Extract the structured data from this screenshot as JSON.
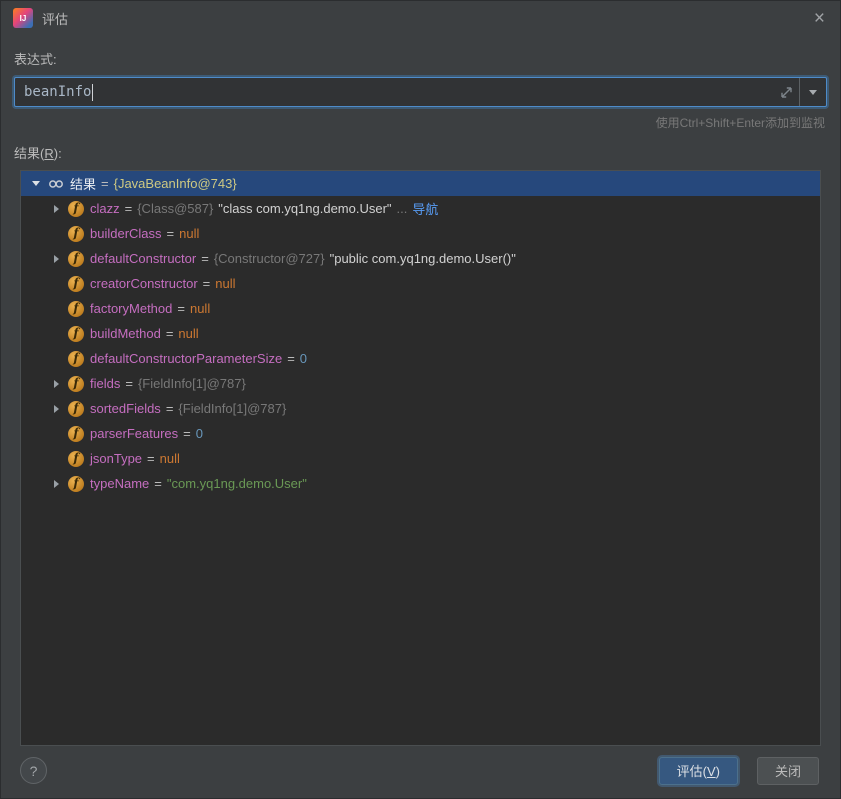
{
  "dialog": {
    "title": "评估"
  },
  "icons": {
    "close": "×",
    "help": "?",
    "logo": "IJ",
    "field": "f"
  },
  "colors": {
    "selection_bg": "#26487C",
    "primary_button_bg": "#365880",
    "focus_border_blue": "#4E8BC9",
    "field_name_pink": "#C56EC0",
    "string_green": "#6A9955",
    "null_orange": "#CC7832",
    "number_blue": "#6897BB",
    "reference_gray": "#787878",
    "link_blue": "#589DF6"
  },
  "expression": {
    "label": "表达式:",
    "value": "beanInfo",
    "hint": "使用Ctrl+Shift+Enter添加到监视"
  },
  "result": {
    "label_prefix": "结果(",
    "label_mnemonic": "R",
    "label_suffix": "):",
    "root": {
      "expand": true,
      "name": "结果",
      "values": [
        {
          "type": "eq",
          "text": "="
        },
        {
          "type": "rootref",
          "text": "{JavaBeanInfo@743}"
        }
      ]
    },
    "rows": [
      {
        "expand": true,
        "name": "clazz",
        "values": [
          {
            "type": "eq",
            "text": "="
          },
          {
            "type": "ref",
            "text": "{Class@587}"
          },
          {
            "type": "plain",
            "text": "\"class com.yq1ng.demo.User\""
          },
          {
            "type": "dots",
            "text": "..."
          },
          {
            "type": "link",
            "text": "导航"
          }
        ]
      },
      {
        "expand": false,
        "name": "builderClass",
        "values": [
          {
            "type": "eq",
            "text": "="
          },
          {
            "type": "null",
            "text": "null"
          }
        ]
      },
      {
        "expand": true,
        "name": "defaultConstructor",
        "values": [
          {
            "type": "eq",
            "text": "="
          },
          {
            "type": "ref",
            "text": "{Constructor@727}"
          },
          {
            "type": "plain",
            "text": "\"public com.yq1ng.demo.User()\""
          }
        ]
      },
      {
        "expand": false,
        "name": "creatorConstructor",
        "values": [
          {
            "type": "eq",
            "text": "="
          },
          {
            "type": "null",
            "text": "null"
          }
        ]
      },
      {
        "expand": false,
        "name": "factoryMethod",
        "values": [
          {
            "type": "eq",
            "text": "="
          },
          {
            "type": "null",
            "text": "null"
          }
        ]
      },
      {
        "expand": false,
        "name": "buildMethod",
        "values": [
          {
            "type": "eq",
            "text": "="
          },
          {
            "type": "null",
            "text": "null"
          }
        ]
      },
      {
        "expand": false,
        "name": "defaultConstructorParameterSize",
        "values": [
          {
            "type": "eq",
            "text": "="
          },
          {
            "type": "num",
            "text": "0"
          }
        ]
      },
      {
        "expand": true,
        "name": "fields",
        "values": [
          {
            "type": "eq",
            "text": "="
          },
          {
            "type": "ref",
            "text": "{FieldInfo[1]@787}"
          }
        ]
      },
      {
        "expand": true,
        "name": "sortedFields",
        "values": [
          {
            "type": "eq",
            "text": "="
          },
          {
            "type": "ref",
            "text": "{FieldInfo[1]@787}"
          }
        ]
      },
      {
        "expand": false,
        "name": "parserFeatures",
        "values": [
          {
            "type": "eq",
            "text": "="
          },
          {
            "type": "num",
            "text": "0"
          }
        ]
      },
      {
        "expand": false,
        "name": "jsonType",
        "values": [
          {
            "type": "eq",
            "text": "="
          },
          {
            "type": "null",
            "text": "null"
          }
        ]
      },
      {
        "expand": true,
        "name": "typeName",
        "values": [
          {
            "type": "eq",
            "text": "="
          },
          {
            "type": "str",
            "text": "\"com.yq1ng.demo.User\""
          }
        ]
      }
    ]
  },
  "footer": {
    "evaluate": {
      "prefix": "评估(",
      "mnemonic": "V",
      "suffix": ")"
    },
    "close_label": "关闭"
  }
}
